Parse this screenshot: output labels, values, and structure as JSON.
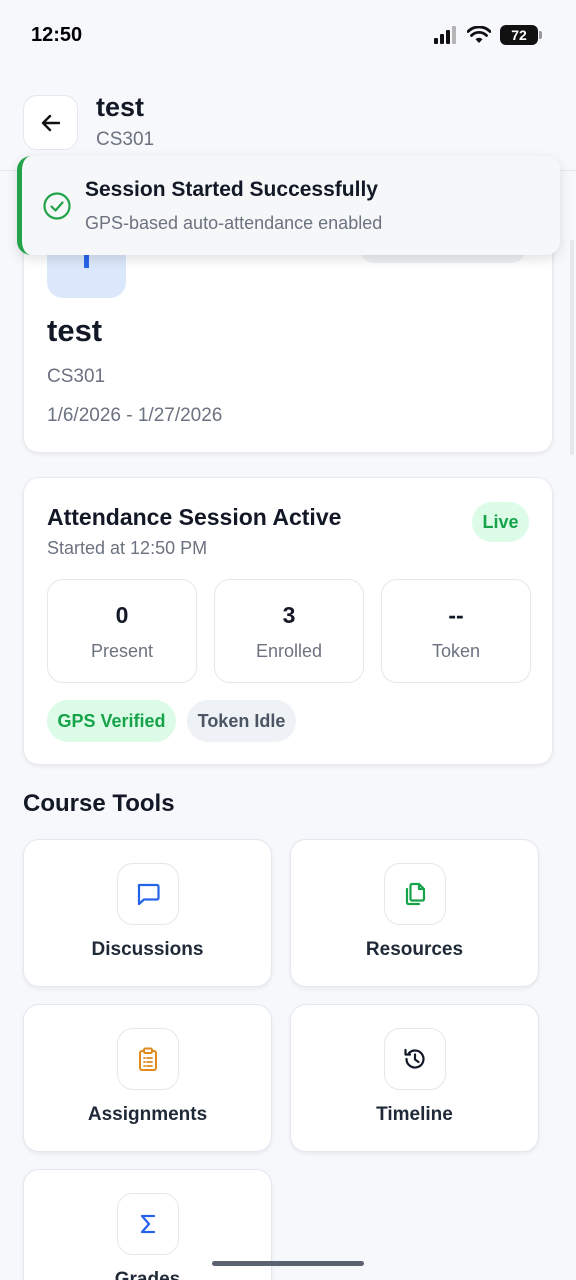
{
  "status_bar": {
    "time": "12:50",
    "battery": "72"
  },
  "header": {
    "title": "test",
    "subtitle": "CS301",
    "back_icon": "arrow-left-icon"
  },
  "toast": {
    "title": "Session Started Successfully",
    "message": "GPS-based auto-attendance enabled",
    "icon": "check-circle-icon",
    "accent": "#22a34a"
  },
  "course": {
    "avatar_letter": "T",
    "title": "test",
    "code": "CS301",
    "dates": "1/6/2026 - 1/27/2026"
  },
  "attendance": {
    "title": "Attendance Session Active",
    "started": "Started at 12:50 PM",
    "live_label": "Live",
    "stats": [
      {
        "value": "0",
        "label": "Present"
      },
      {
        "value": "3",
        "label": "Enrolled"
      },
      {
        "value": "--",
        "label": "Token"
      }
    ],
    "chips": {
      "gps": "GPS Verified",
      "token": "Token Idle"
    }
  },
  "tools": {
    "heading": "Course Tools",
    "items": [
      {
        "label": "Discussions",
        "icon": "chat-icon",
        "color": "#2563eb"
      },
      {
        "label": "Resources",
        "icon": "files-icon",
        "color": "#16a34a"
      },
      {
        "label": "Assignments",
        "icon": "clipboard-icon",
        "color": "#e08a1a"
      },
      {
        "label": "Timeline",
        "icon": "history-icon",
        "color": "#111827"
      },
      {
        "label": "Grades",
        "icon": "sigma-icon",
        "color": "#2563eb"
      }
    ]
  }
}
